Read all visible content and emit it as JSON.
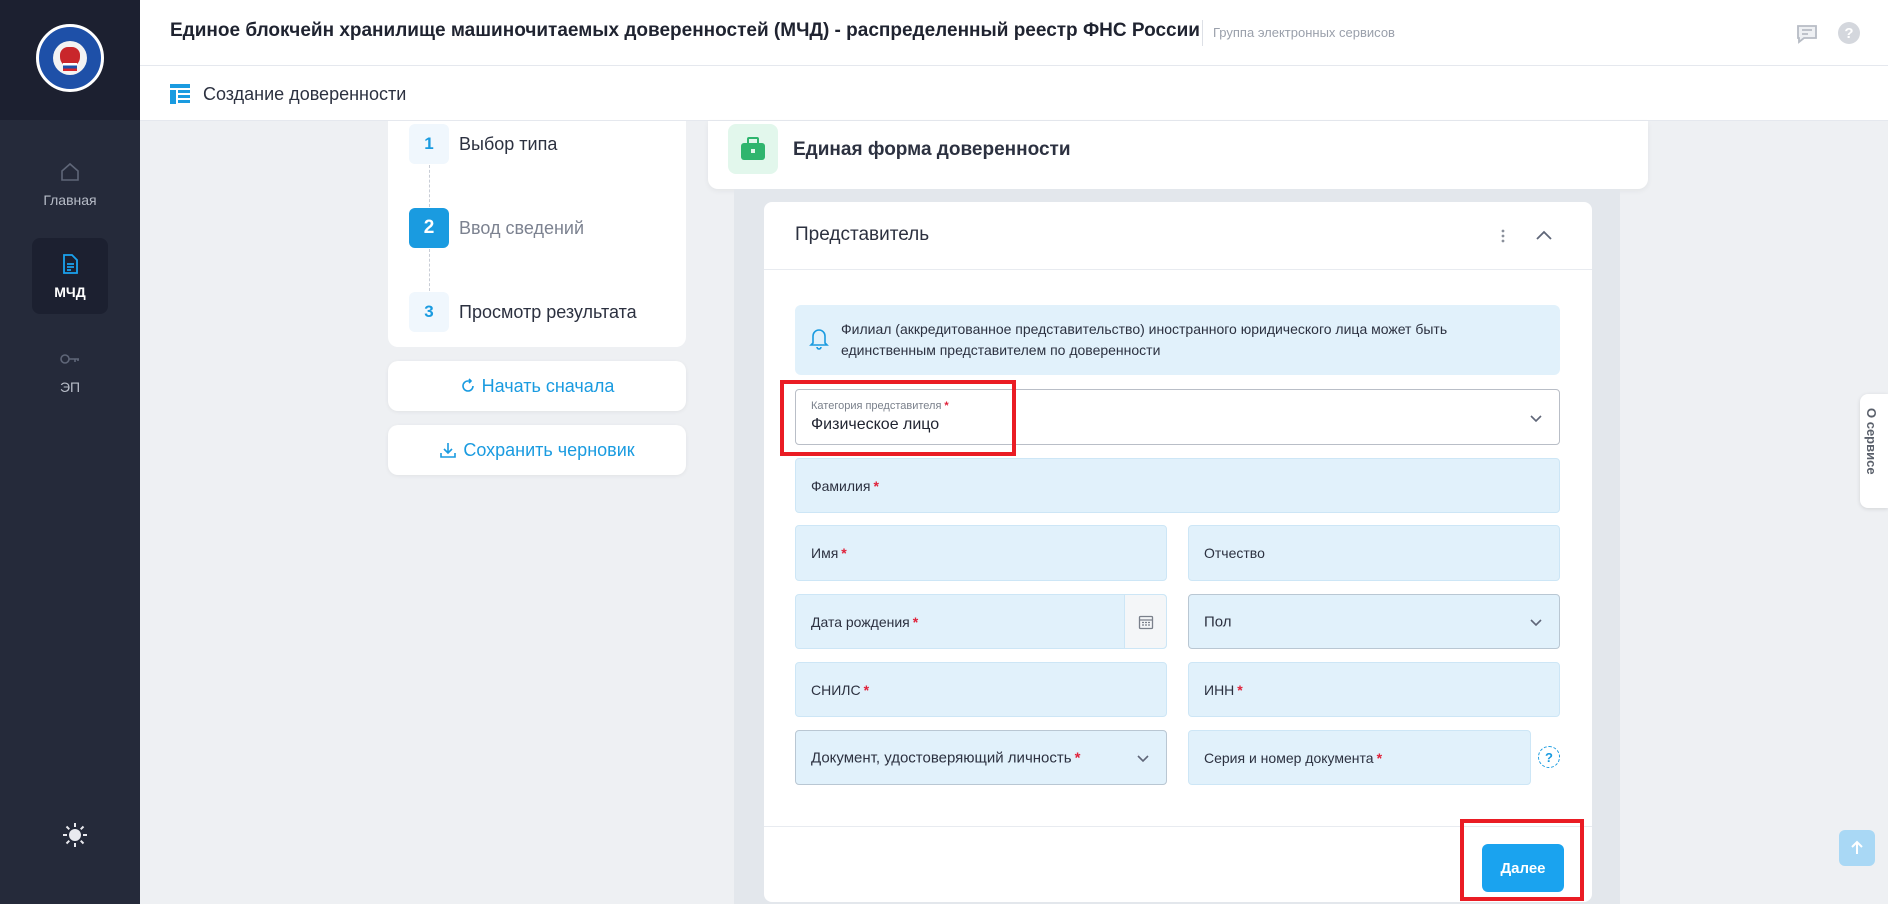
{
  "header": {
    "title": "Единое блокчейн хранилище машиночитаемых доверенностей (МЧД) - распределенный реестр ФНС России",
    "subtitle": "Группа электронных сервисов",
    "chat_icon": "chat-icon",
    "help_label": "?"
  },
  "sidebar": {
    "logo": "fns-emblem-logo",
    "items": [
      {
        "label": "Главная",
        "icon": "home-icon"
      },
      {
        "label": "МЧД",
        "icon": "document-icon",
        "active": true
      },
      {
        "label": "ЭП",
        "icon": "key-icon"
      }
    ],
    "theme_icon": "sun-icon"
  },
  "subheader": {
    "title": "Создание доверенности",
    "icon": "layout-icon"
  },
  "steps": [
    {
      "num": "1",
      "label": "Выбор типа"
    },
    {
      "num": "2",
      "label": "Ввод сведений",
      "active": true
    },
    {
      "num": "3",
      "label": "Просмотр результата"
    }
  ],
  "actions": {
    "restart": "Начать сначала",
    "save_draft": "Сохранить черновик"
  },
  "form": {
    "title": "Единая форма доверенности",
    "section_title": "Представитель",
    "info": "Филиал (аккредитованное представительство) иностранного юридического лица может быть единственным представителем по доверенности",
    "category_label": "Категория представителя",
    "category_value": "Физическое лицо",
    "fields": {
      "last_name": "Фамилия",
      "first_name": "Имя",
      "patronymic": "Отчество",
      "birth_date": "Дата рождения",
      "gender": "Пол",
      "snils": "СНИЛС",
      "inn": "ИНН",
      "id_doc": "Документ, удостоверяющий личность",
      "doc_number": "Серия и номер документа"
    },
    "required_mark": "*",
    "doc_help": "?",
    "next": "Далее"
  },
  "about_tab": "О сервисе",
  "colors": {
    "accent": "#1aa3ef",
    "sidebar": "#252a3a",
    "field_bg": "#e1f1fb",
    "highlight": "#ea1c24",
    "required": "#e0223a"
  }
}
